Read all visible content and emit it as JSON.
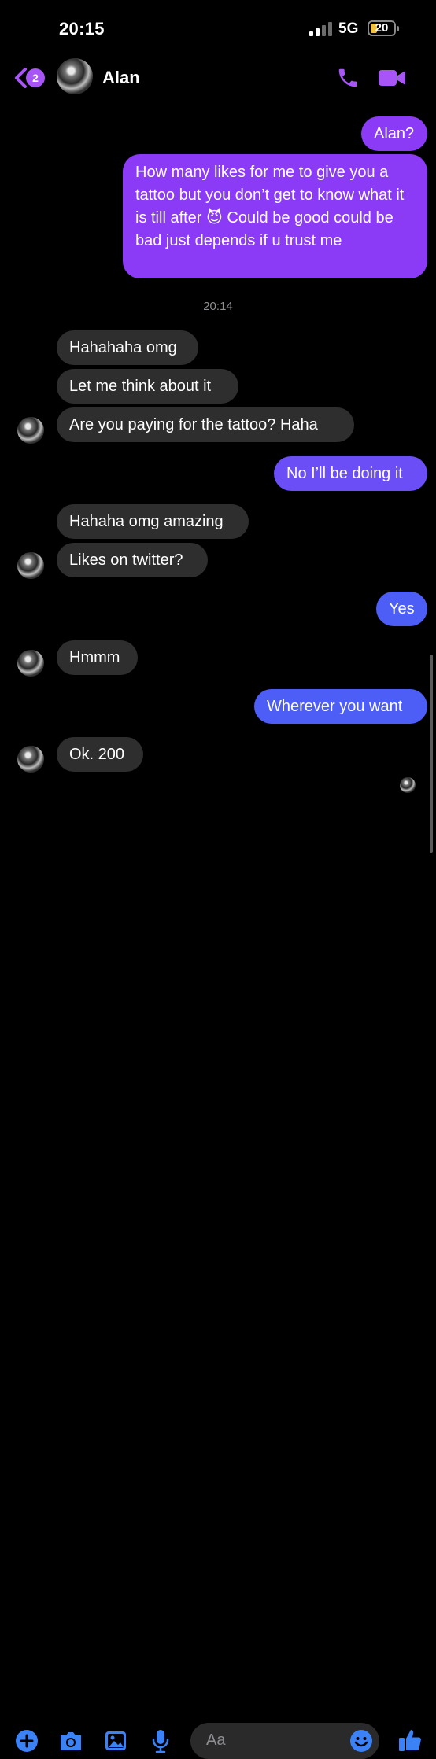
{
  "status_bar": {
    "time": "20:15",
    "network": "5G",
    "battery": "20"
  },
  "header": {
    "back_badge": "2",
    "contact_name": "Alan"
  },
  "messages": [
    {
      "text": "Alan?"
    },
    {
      "text": "How many likes for me to give you a tattoo but you don’t get to know what it is till after 😈 Could be good could be bad just depends if u trust me"
    },
    {
      "text": "Hahahaha omg"
    },
    {
      "text": "Let me think about it"
    },
    {
      "text": "Are you paying for the tattoo? Haha"
    },
    {
      "text": "No I’ll be doing it"
    },
    {
      "text": "Hahaha omg amazing"
    },
    {
      "text": "Likes on twitter?"
    },
    {
      "text": "Yes"
    },
    {
      "text": "Hmmm"
    },
    {
      "text": "Wherever you want"
    },
    {
      "text": "Ok. 200"
    }
  ],
  "timestamp": "20:14",
  "composer": {
    "placeholder": "Aa"
  },
  "colors": {
    "accent": "#a855f7",
    "incoming": "#2e2e2e",
    "outgoing_purple": "#8b3bf6",
    "outgoing_blue": "#4d5ef7",
    "icon_blue": "#3b82f6"
  },
  "icons": [
    "back-chevron-icon",
    "phone-icon",
    "video-camera-icon",
    "plus-icon",
    "camera-icon",
    "image-icon",
    "microphone-icon",
    "emoji-icon",
    "thumbs-up-icon"
  ]
}
